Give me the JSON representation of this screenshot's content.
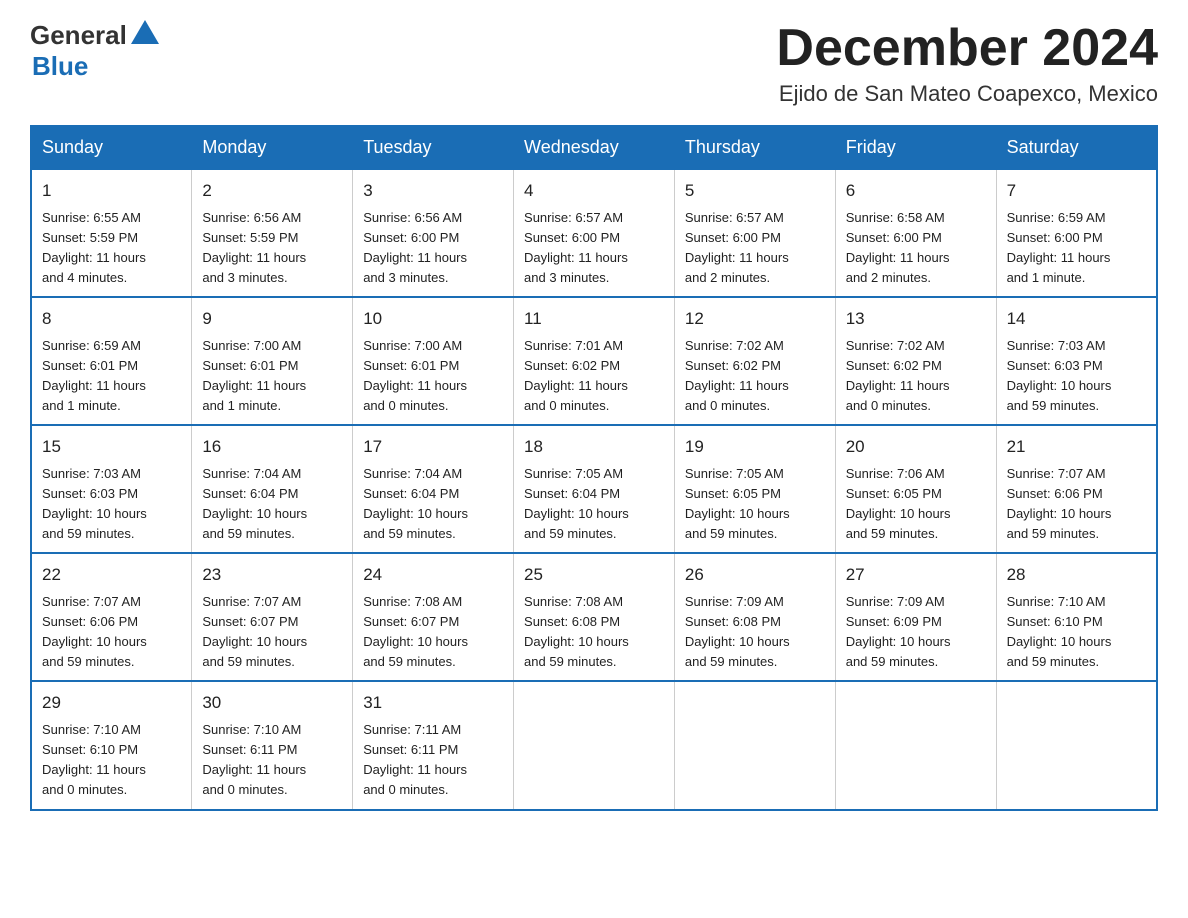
{
  "logo": {
    "general": "General",
    "blue": "Blue"
  },
  "title": "December 2024",
  "subtitle": "Ejido de San Mateo Coapexco, Mexico",
  "weekdays": [
    "Sunday",
    "Monday",
    "Tuesday",
    "Wednesday",
    "Thursday",
    "Friday",
    "Saturday"
  ],
  "weeks": [
    [
      {
        "day": "1",
        "info": "Sunrise: 6:55 AM\nSunset: 5:59 PM\nDaylight: 11 hours\nand 4 minutes."
      },
      {
        "day": "2",
        "info": "Sunrise: 6:56 AM\nSunset: 5:59 PM\nDaylight: 11 hours\nand 3 minutes."
      },
      {
        "day": "3",
        "info": "Sunrise: 6:56 AM\nSunset: 6:00 PM\nDaylight: 11 hours\nand 3 minutes."
      },
      {
        "day": "4",
        "info": "Sunrise: 6:57 AM\nSunset: 6:00 PM\nDaylight: 11 hours\nand 3 minutes."
      },
      {
        "day": "5",
        "info": "Sunrise: 6:57 AM\nSunset: 6:00 PM\nDaylight: 11 hours\nand 2 minutes."
      },
      {
        "day": "6",
        "info": "Sunrise: 6:58 AM\nSunset: 6:00 PM\nDaylight: 11 hours\nand 2 minutes."
      },
      {
        "day": "7",
        "info": "Sunrise: 6:59 AM\nSunset: 6:00 PM\nDaylight: 11 hours\nand 1 minute."
      }
    ],
    [
      {
        "day": "8",
        "info": "Sunrise: 6:59 AM\nSunset: 6:01 PM\nDaylight: 11 hours\nand 1 minute."
      },
      {
        "day": "9",
        "info": "Sunrise: 7:00 AM\nSunset: 6:01 PM\nDaylight: 11 hours\nand 1 minute."
      },
      {
        "day": "10",
        "info": "Sunrise: 7:00 AM\nSunset: 6:01 PM\nDaylight: 11 hours\nand 0 minutes."
      },
      {
        "day": "11",
        "info": "Sunrise: 7:01 AM\nSunset: 6:02 PM\nDaylight: 11 hours\nand 0 minutes."
      },
      {
        "day": "12",
        "info": "Sunrise: 7:02 AM\nSunset: 6:02 PM\nDaylight: 11 hours\nand 0 minutes."
      },
      {
        "day": "13",
        "info": "Sunrise: 7:02 AM\nSunset: 6:02 PM\nDaylight: 11 hours\nand 0 minutes."
      },
      {
        "day": "14",
        "info": "Sunrise: 7:03 AM\nSunset: 6:03 PM\nDaylight: 10 hours\nand 59 minutes."
      }
    ],
    [
      {
        "day": "15",
        "info": "Sunrise: 7:03 AM\nSunset: 6:03 PM\nDaylight: 10 hours\nand 59 minutes."
      },
      {
        "day": "16",
        "info": "Sunrise: 7:04 AM\nSunset: 6:04 PM\nDaylight: 10 hours\nand 59 minutes."
      },
      {
        "day": "17",
        "info": "Sunrise: 7:04 AM\nSunset: 6:04 PM\nDaylight: 10 hours\nand 59 minutes."
      },
      {
        "day": "18",
        "info": "Sunrise: 7:05 AM\nSunset: 6:04 PM\nDaylight: 10 hours\nand 59 minutes."
      },
      {
        "day": "19",
        "info": "Sunrise: 7:05 AM\nSunset: 6:05 PM\nDaylight: 10 hours\nand 59 minutes."
      },
      {
        "day": "20",
        "info": "Sunrise: 7:06 AM\nSunset: 6:05 PM\nDaylight: 10 hours\nand 59 minutes."
      },
      {
        "day": "21",
        "info": "Sunrise: 7:07 AM\nSunset: 6:06 PM\nDaylight: 10 hours\nand 59 minutes."
      }
    ],
    [
      {
        "day": "22",
        "info": "Sunrise: 7:07 AM\nSunset: 6:06 PM\nDaylight: 10 hours\nand 59 minutes."
      },
      {
        "day": "23",
        "info": "Sunrise: 7:07 AM\nSunset: 6:07 PM\nDaylight: 10 hours\nand 59 minutes."
      },
      {
        "day": "24",
        "info": "Sunrise: 7:08 AM\nSunset: 6:07 PM\nDaylight: 10 hours\nand 59 minutes."
      },
      {
        "day": "25",
        "info": "Sunrise: 7:08 AM\nSunset: 6:08 PM\nDaylight: 10 hours\nand 59 minutes."
      },
      {
        "day": "26",
        "info": "Sunrise: 7:09 AM\nSunset: 6:08 PM\nDaylight: 10 hours\nand 59 minutes."
      },
      {
        "day": "27",
        "info": "Sunrise: 7:09 AM\nSunset: 6:09 PM\nDaylight: 10 hours\nand 59 minutes."
      },
      {
        "day": "28",
        "info": "Sunrise: 7:10 AM\nSunset: 6:10 PM\nDaylight: 10 hours\nand 59 minutes."
      }
    ],
    [
      {
        "day": "29",
        "info": "Sunrise: 7:10 AM\nSunset: 6:10 PM\nDaylight: 11 hours\nand 0 minutes."
      },
      {
        "day": "30",
        "info": "Sunrise: 7:10 AM\nSunset: 6:11 PM\nDaylight: 11 hours\nand 0 minutes."
      },
      {
        "day": "31",
        "info": "Sunrise: 7:11 AM\nSunset: 6:11 PM\nDaylight: 11 hours\nand 0 minutes."
      },
      {
        "day": "",
        "info": ""
      },
      {
        "day": "",
        "info": ""
      },
      {
        "day": "",
        "info": ""
      },
      {
        "day": "",
        "info": ""
      }
    ]
  ]
}
